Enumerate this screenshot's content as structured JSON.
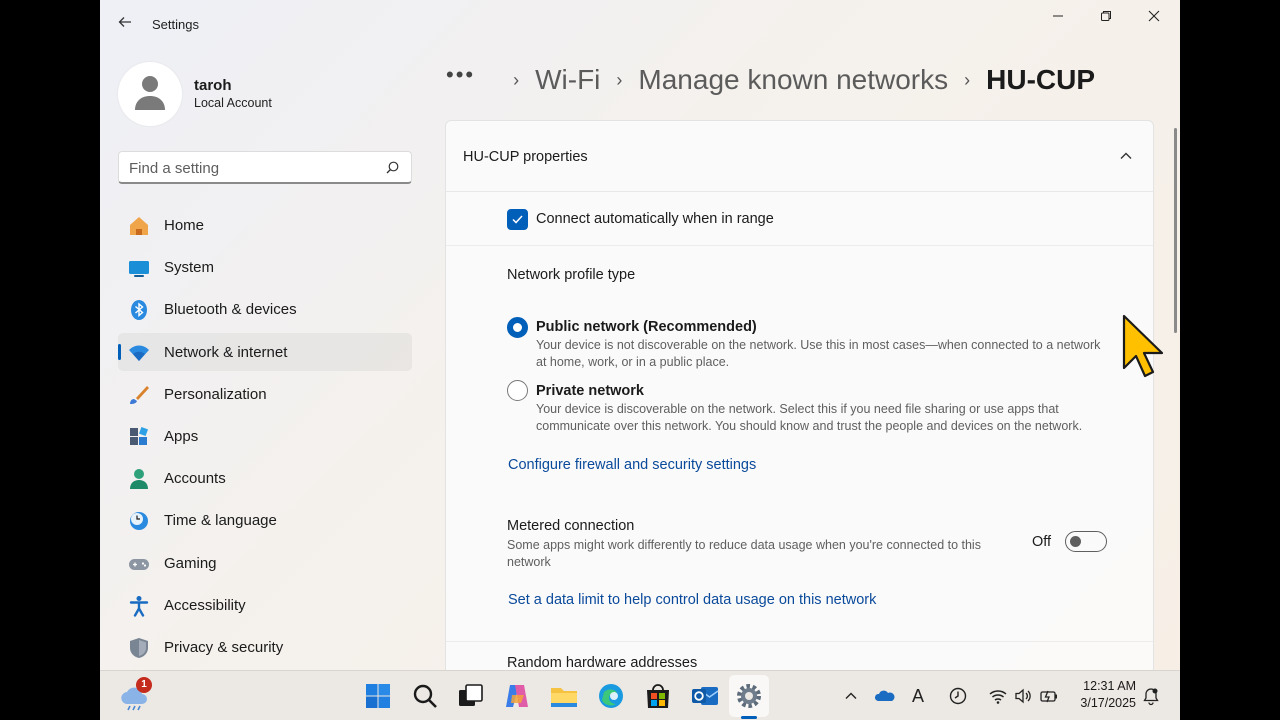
{
  "window": {
    "title": "Settings",
    "back_icon": "back-arrow-icon",
    "minimize_icon": "minimize-icon",
    "restore_icon": "restore-icon",
    "close_icon": "close-icon"
  },
  "user": {
    "name": "taroh",
    "account_type": "Local Account"
  },
  "search": {
    "placeholder": "Find a setting"
  },
  "sidebar": {
    "items": [
      {
        "label": "Home",
        "icon": "home-icon"
      },
      {
        "label": "System",
        "icon": "system-icon"
      },
      {
        "label": "Bluetooth & devices",
        "icon": "bluetooth-icon"
      },
      {
        "label": "Network & internet",
        "icon": "network-icon",
        "active": true
      },
      {
        "label": "Personalization",
        "icon": "brush-icon"
      },
      {
        "label": "Apps",
        "icon": "apps-icon"
      },
      {
        "label": "Accounts",
        "icon": "accounts-icon"
      },
      {
        "label": "Time & language",
        "icon": "clock-globe-icon"
      },
      {
        "label": "Gaming",
        "icon": "gamepad-icon"
      },
      {
        "label": "Accessibility",
        "icon": "accessibility-icon"
      },
      {
        "label": "Privacy & security",
        "icon": "shield-icon"
      }
    ]
  },
  "breadcrumb": {
    "more": "•••",
    "sep": "›",
    "items": [
      "Wi-Fi",
      "Manage known networks"
    ],
    "current": "HU-CUP"
  },
  "properties": {
    "header": "HU-CUP properties",
    "auto_connect": {
      "label": "Connect automatically when in range",
      "checked": true
    },
    "profile_type_label": "Network profile type",
    "public": {
      "title": "Public network (Recommended)",
      "desc": "Your device is not discoverable on the network. Use this in most cases—when connected to a network at home, work, or in a public place.",
      "selected": true
    },
    "private": {
      "title": "Private network",
      "desc": "Your device is discoverable on the network. Select this if you need file sharing or use apps that communicate over this network. You should know and trust the people and devices on the network.",
      "selected": false
    },
    "firewall_link": "Configure firewall and security settings",
    "metered": {
      "title": "Metered connection",
      "desc": "Some apps might work differently to reduce data usage when you're connected to this network",
      "state_label": "Off",
      "on": false
    },
    "data_limit_link": "Set a data limit to help control data usage on this network",
    "random_hw": "Random hardware addresses"
  },
  "taskbar": {
    "weather_badge": "1",
    "apps": [
      "start-icon",
      "search-icon",
      "task-view-icon",
      "copilot-icon",
      "file-explorer-icon",
      "edge-icon",
      "store-icon",
      "outlook-icon",
      "settings-icon"
    ],
    "tray": [
      "chevron-up-icon",
      "onedrive-icon",
      "ime-icon",
      "focus-icon",
      "wifi-icon",
      "volume-icon",
      "battery-icon"
    ],
    "ime_label": "A",
    "time": "12:31 AM",
    "date": "3/17/2025"
  },
  "colors": {
    "accent": "#005fb8",
    "link": "#0a4a9b",
    "cursor": "#ffc000"
  }
}
